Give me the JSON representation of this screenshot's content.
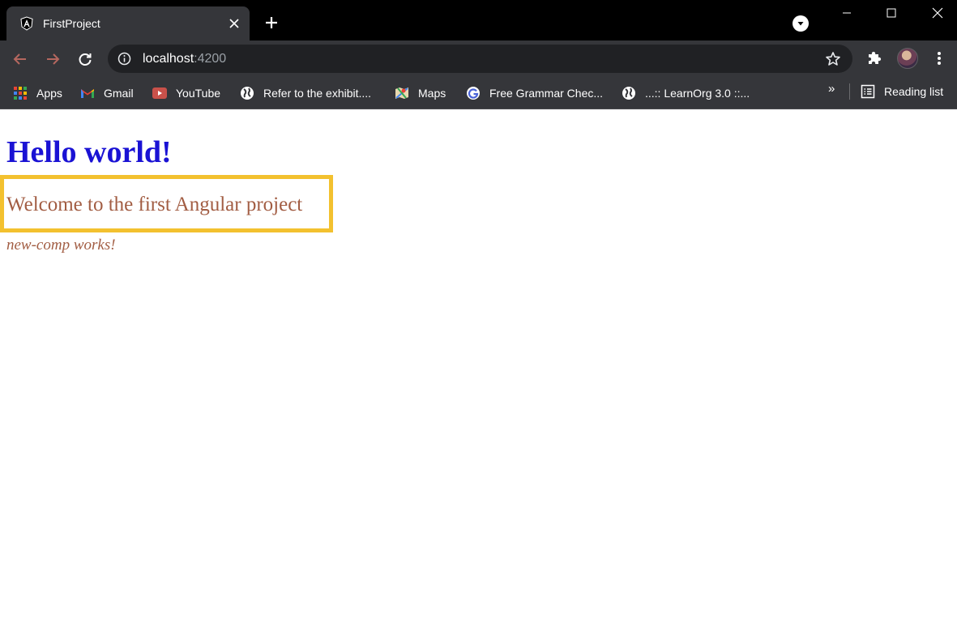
{
  "browser": {
    "tab": {
      "title": "FirstProject",
      "favicon": "angular-icon"
    },
    "address_bar": {
      "host": "localhost",
      "port": ":4200"
    },
    "bookmarks": [
      {
        "label": "Apps",
        "icon": "apps-grid-icon"
      },
      {
        "label": "Gmail",
        "icon": "gmail-icon"
      },
      {
        "label": "YouTube",
        "icon": "youtube-icon"
      },
      {
        "label": "Refer to the exhibit....",
        "icon": "globe-icon"
      },
      {
        "label": "Maps",
        "icon": "maps-icon"
      },
      {
        "label": "Free Grammar Chec...",
        "icon": "google-icon"
      },
      {
        "label": "...:: LearnOrg 3.0 ::...",
        "icon": "globe-icon"
      }
    ],
    "overflow_label": "»",
    "reading_list": "Reading list",
    "colors": {
      "frame": "#000000",
      "toolbar": "#35363a",
      "omnibox": "#202124"
    }
  },
  "page": {
    "heading": "Hello world!",
    "welcome_text": "Welcome to the first Angular project",
    "component_text": "new-comp works!",
    "colors": {
      "heading": "#1a12d4",
      "text": "#a25d43",
      "highlight_border": "#f3c12f"
    }
  }
}
